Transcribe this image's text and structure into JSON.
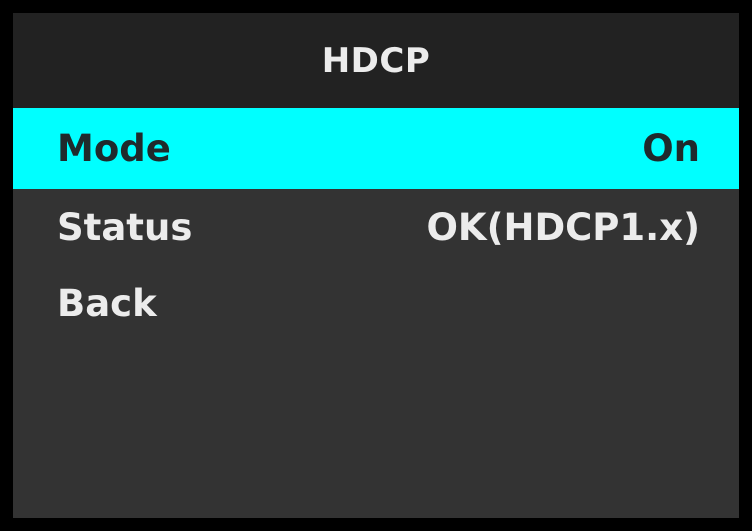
{
  "header": {
    "title": "HDCP"
  },
  "menu": {
    "items": [
      {
        "label": "Mode",
        "value": "On",
        "selected": true
      },
      {
        "label": "Status",
        "value": "OK(HDCP1.x)",
        "selected": false
      },
      {
        "label": "Back",
        "value": "",
        "selected": false
      }
    ]
  },
  "colors": {
    "highlight": "#00ffff",
    "background": "#333333",
    "header_background": "#222222",
    "border": "#000000",
    "text": "#ececec"
  }
}
